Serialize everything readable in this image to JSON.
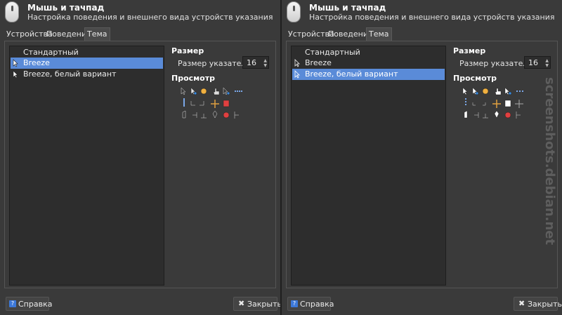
{
  "windows": [
    {
      "title": "Мышь и тачпад",
      "subtitle": "Настройка поведения и внешнего вида устройств указания",
      "tabs": [
        "Устройства",
        "Поведение",
        "Тема"
      ],
      "themes": [
        "Стандартный",
        "Breeze",
        "Breeze, белый вариант"
      ],
      "selected_index": 1,
      "size_heading": "Размер",
      "size_label": "Размер указателя:",
      "size_value": "16",
      "preview_heading": "Просмотр",
      "help_button": "Справка",
      "close_button": "Закрыть"
    },
    {
      "title": "Мышь и тачпад",
      "subtitle": "Настройка поведения и внешнего вида устройств указания",
      "tabs": [
        "Устройства",
        "Поведение",
        "Тема"
      ],
      "themes": [
        "Стандартный",
        "Breeze",
        "Breeze, белый вариант"
      ],
      "selected_index": 2,
      "size_heading": "Размер",
      "size_label": "Размер указателя:",
      "size_value": "16",
      "preview_heading": "Просмотр",
      "help_button": "Справка",
      "close_button": "Закрыть"
    }
  ],
  "watermark": "screenshots.debian.net",
  "colors": {
    "selection": "#5a8bd8",
    "background": "#3a3a3a",
    "list": "#2d2d2d"
  }
}
